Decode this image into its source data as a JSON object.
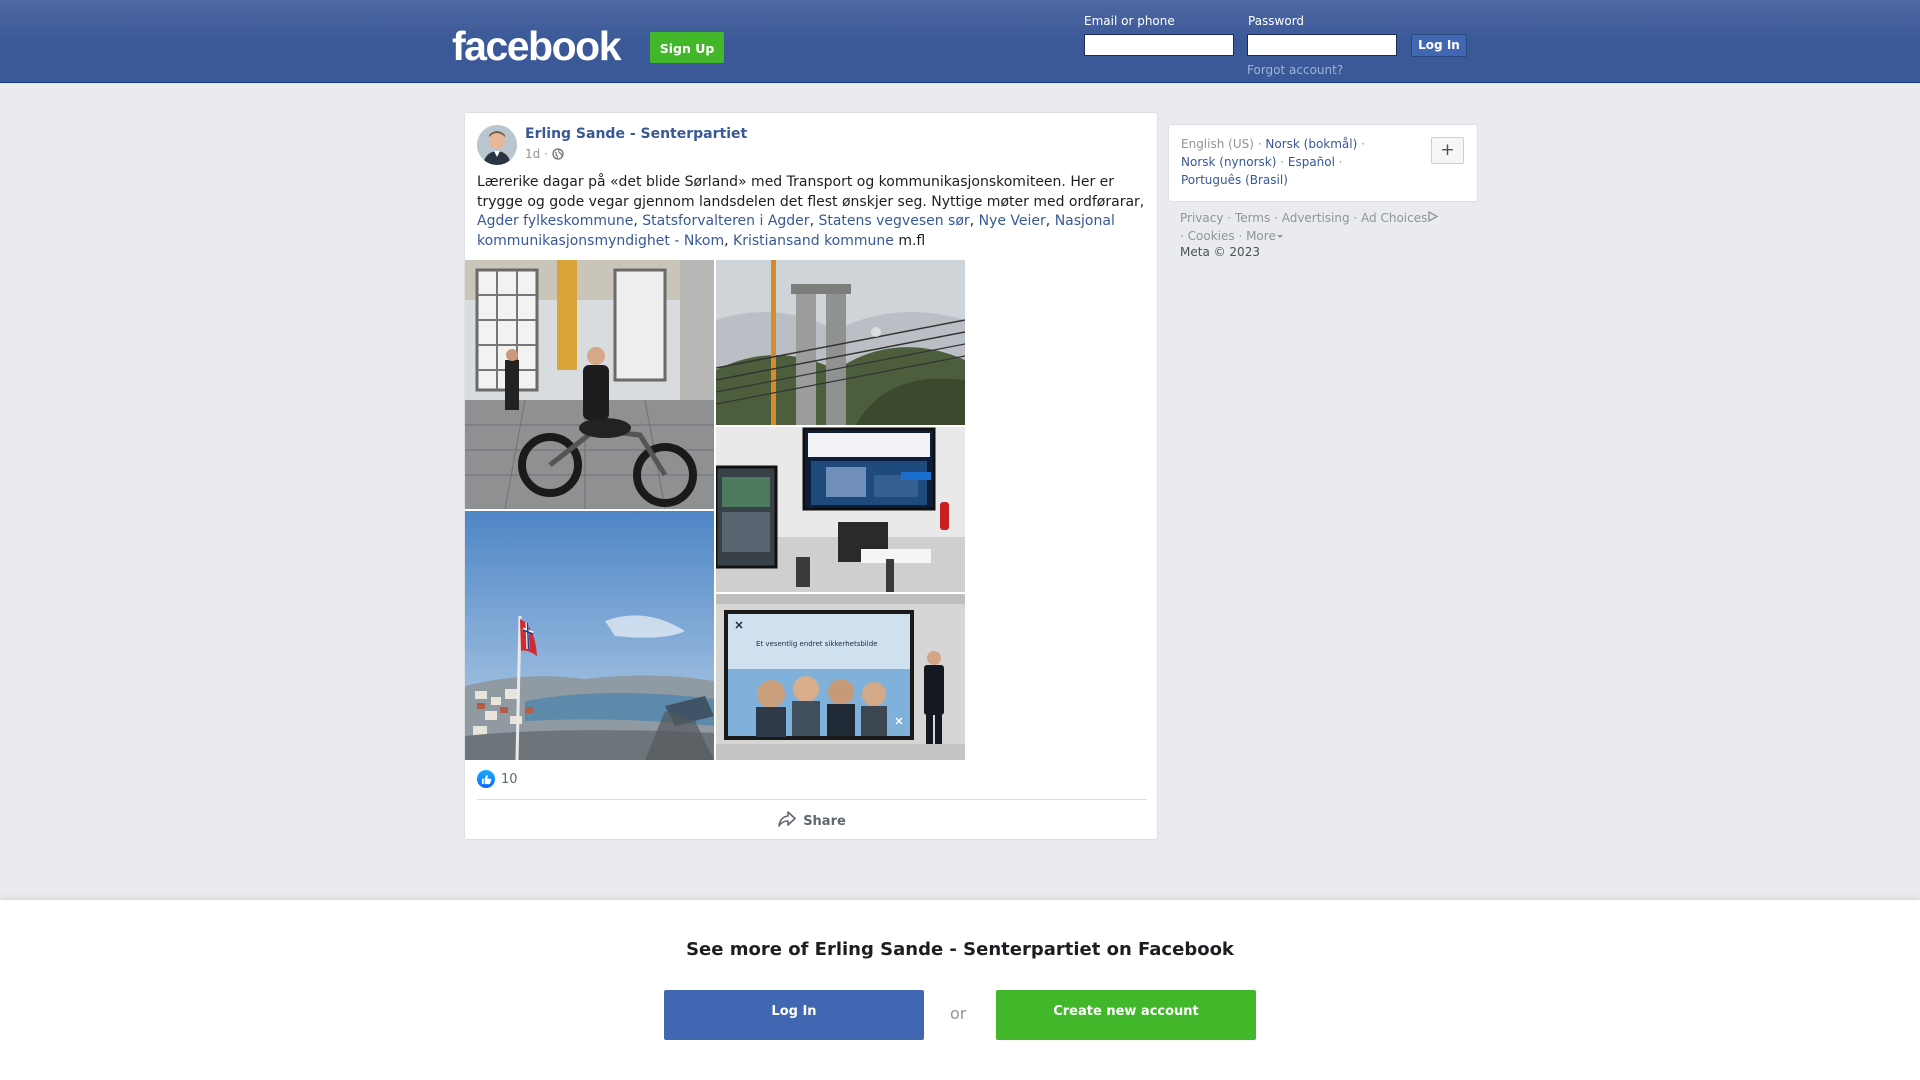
{
  "header": {
    "logo_text": "facebook",
    "signup_label": "Sign Up",
    "email_label": "Email or phone",
    "password_label": "Password",
    "login_label": "Log In",
    "forgot_label": "Forgot account?"
  },
  "post": {
    "author": "Erling Sande - Senterpartiet",
    "time": "1d",
    "separator": "·",
    "text_intro": "Lærerike dagar på «det blide Sørland» med Transport og kommunikasjonskomiteen. Her er trygge og gode vegar gjennom landsdelen det flest ønskjer seg. Nyttige møter med ordførarar,",
    "mentions": [
      "Agder fylkeskommune",
      "Statsforvalteren i Agder",
      "Statens vegvesen sør",
      "Nye Veier",
      "Nasjonal kommunikasjonsmyndighet - Nkom",
      "Kristiansand kommune"
    ],
    "mention_separator": ", ",
    "text_outro": "m.fl",
    "like_count": "10",
    "share_label": "Share",
    "slide_title": "Et vesentlig endret sikkerhetsbilde",
    "photos": [
      {
        "alt": "motorcycle-garage"
      },
      {
        "alt": "bridge-construction"
      },
      {
        "alt": "meeting-room-screens"
      },
      {
        "alt": "norwegian-flag-harbour"
      },
      {
        "alt": "presentation-screen"
      }
    ]
  },
  "sidebar": {
    "languages": [
      {
        "label": "English (US)",
        "current": true
      },
      {
        "label": "Norsk (bokmål)",
        "current": false
      },
      {
        "label": "Norsk (nynorsk)",
        "current": false
      },
      {
        "label": "Español",
        "current": false
      },
      {
        "label": "Português (Brasil)",
        "current": false
      }
    ],
    "more_languages_label": "+",
    "footer_links": [
      "Privacy",
      "Terms",
      "Advertising",
      "Ad Choices",
      "Cookies",
      "More"
    ],
    "copyright": "Meta © 2023"
  },
  "banner": {
    "title": "See more of Erling Sande - Senterpartiet on Facebook",
    "login_label": "Log In",
    "or_label": "or",
    "create_label": "Create new account"
  },
  "colors": {
    "brand_blue": "#3b5998",
    "link_blue": "#385898",
    "green": "#42b72a",
    "page_bg": "#e9ebee"
  }
}
